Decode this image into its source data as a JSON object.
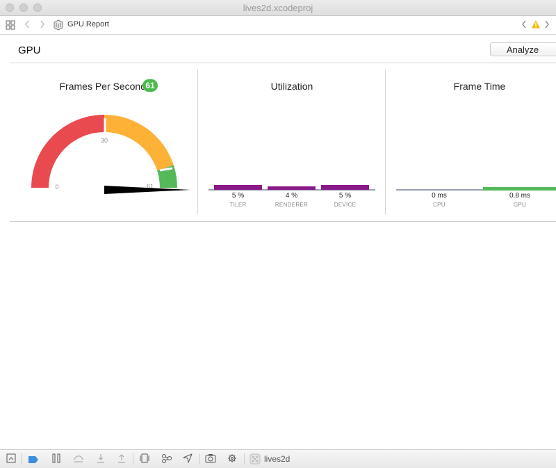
{
  "window": {
    "title": "lives2d.xcodeproj"
  },
  "navbar": {
    "breadcrumb": "GPU Report",
    "back_icon": "chevron-left-icon",
    "forward_icon": "chevron-right-icon"
  },
  "header": {
    "title": "GPU",
    "analyze_label": "Analyze"
  },
  "fps": {
    "title": "Frames Per Second",
    "value": "61",
    "gauge_min_label": "0",
    "gauge_mid_label": "30",
    "gauge_max_label": "61",
    "gauge_value": 61,
    "gauge_max": 60,
    "colors": {
      "low": "#e84a50",
      "mid": "#fdb137",
      "high": "#53b959",
      "badge": "#4cba4c"
    }
  },
  "utilization": {
    "title": "Utilization",
    "bars": [
      {
        "value": "5 %",
        "name": "TILER",
        "percent": 5
      },
      {
        "value": "4 %",
        "name": "RENDERER",
        "percent": 4
      },
      {
        "value": "5 %",
        "name": "DEVICE",
        "percent": 5
      }
    ],
    "color": "#8b1a89"
  },
  "frame_time": {
    "title": "Frame Time",
    "bars": [
      {
        "value": "0 ms",
        "name": "CPU",
        "ms": 0
      },
      {
        "value": "0.8 ms",
        "name": "GPU",
        "ms": 0.8
      }
    ],
    "colors": {
      "cpu": "#9b9fb2",
      "gpu": "#53b959"
    }
  },
  "statusbar": {
    "target": "lives2d"
  }
}
